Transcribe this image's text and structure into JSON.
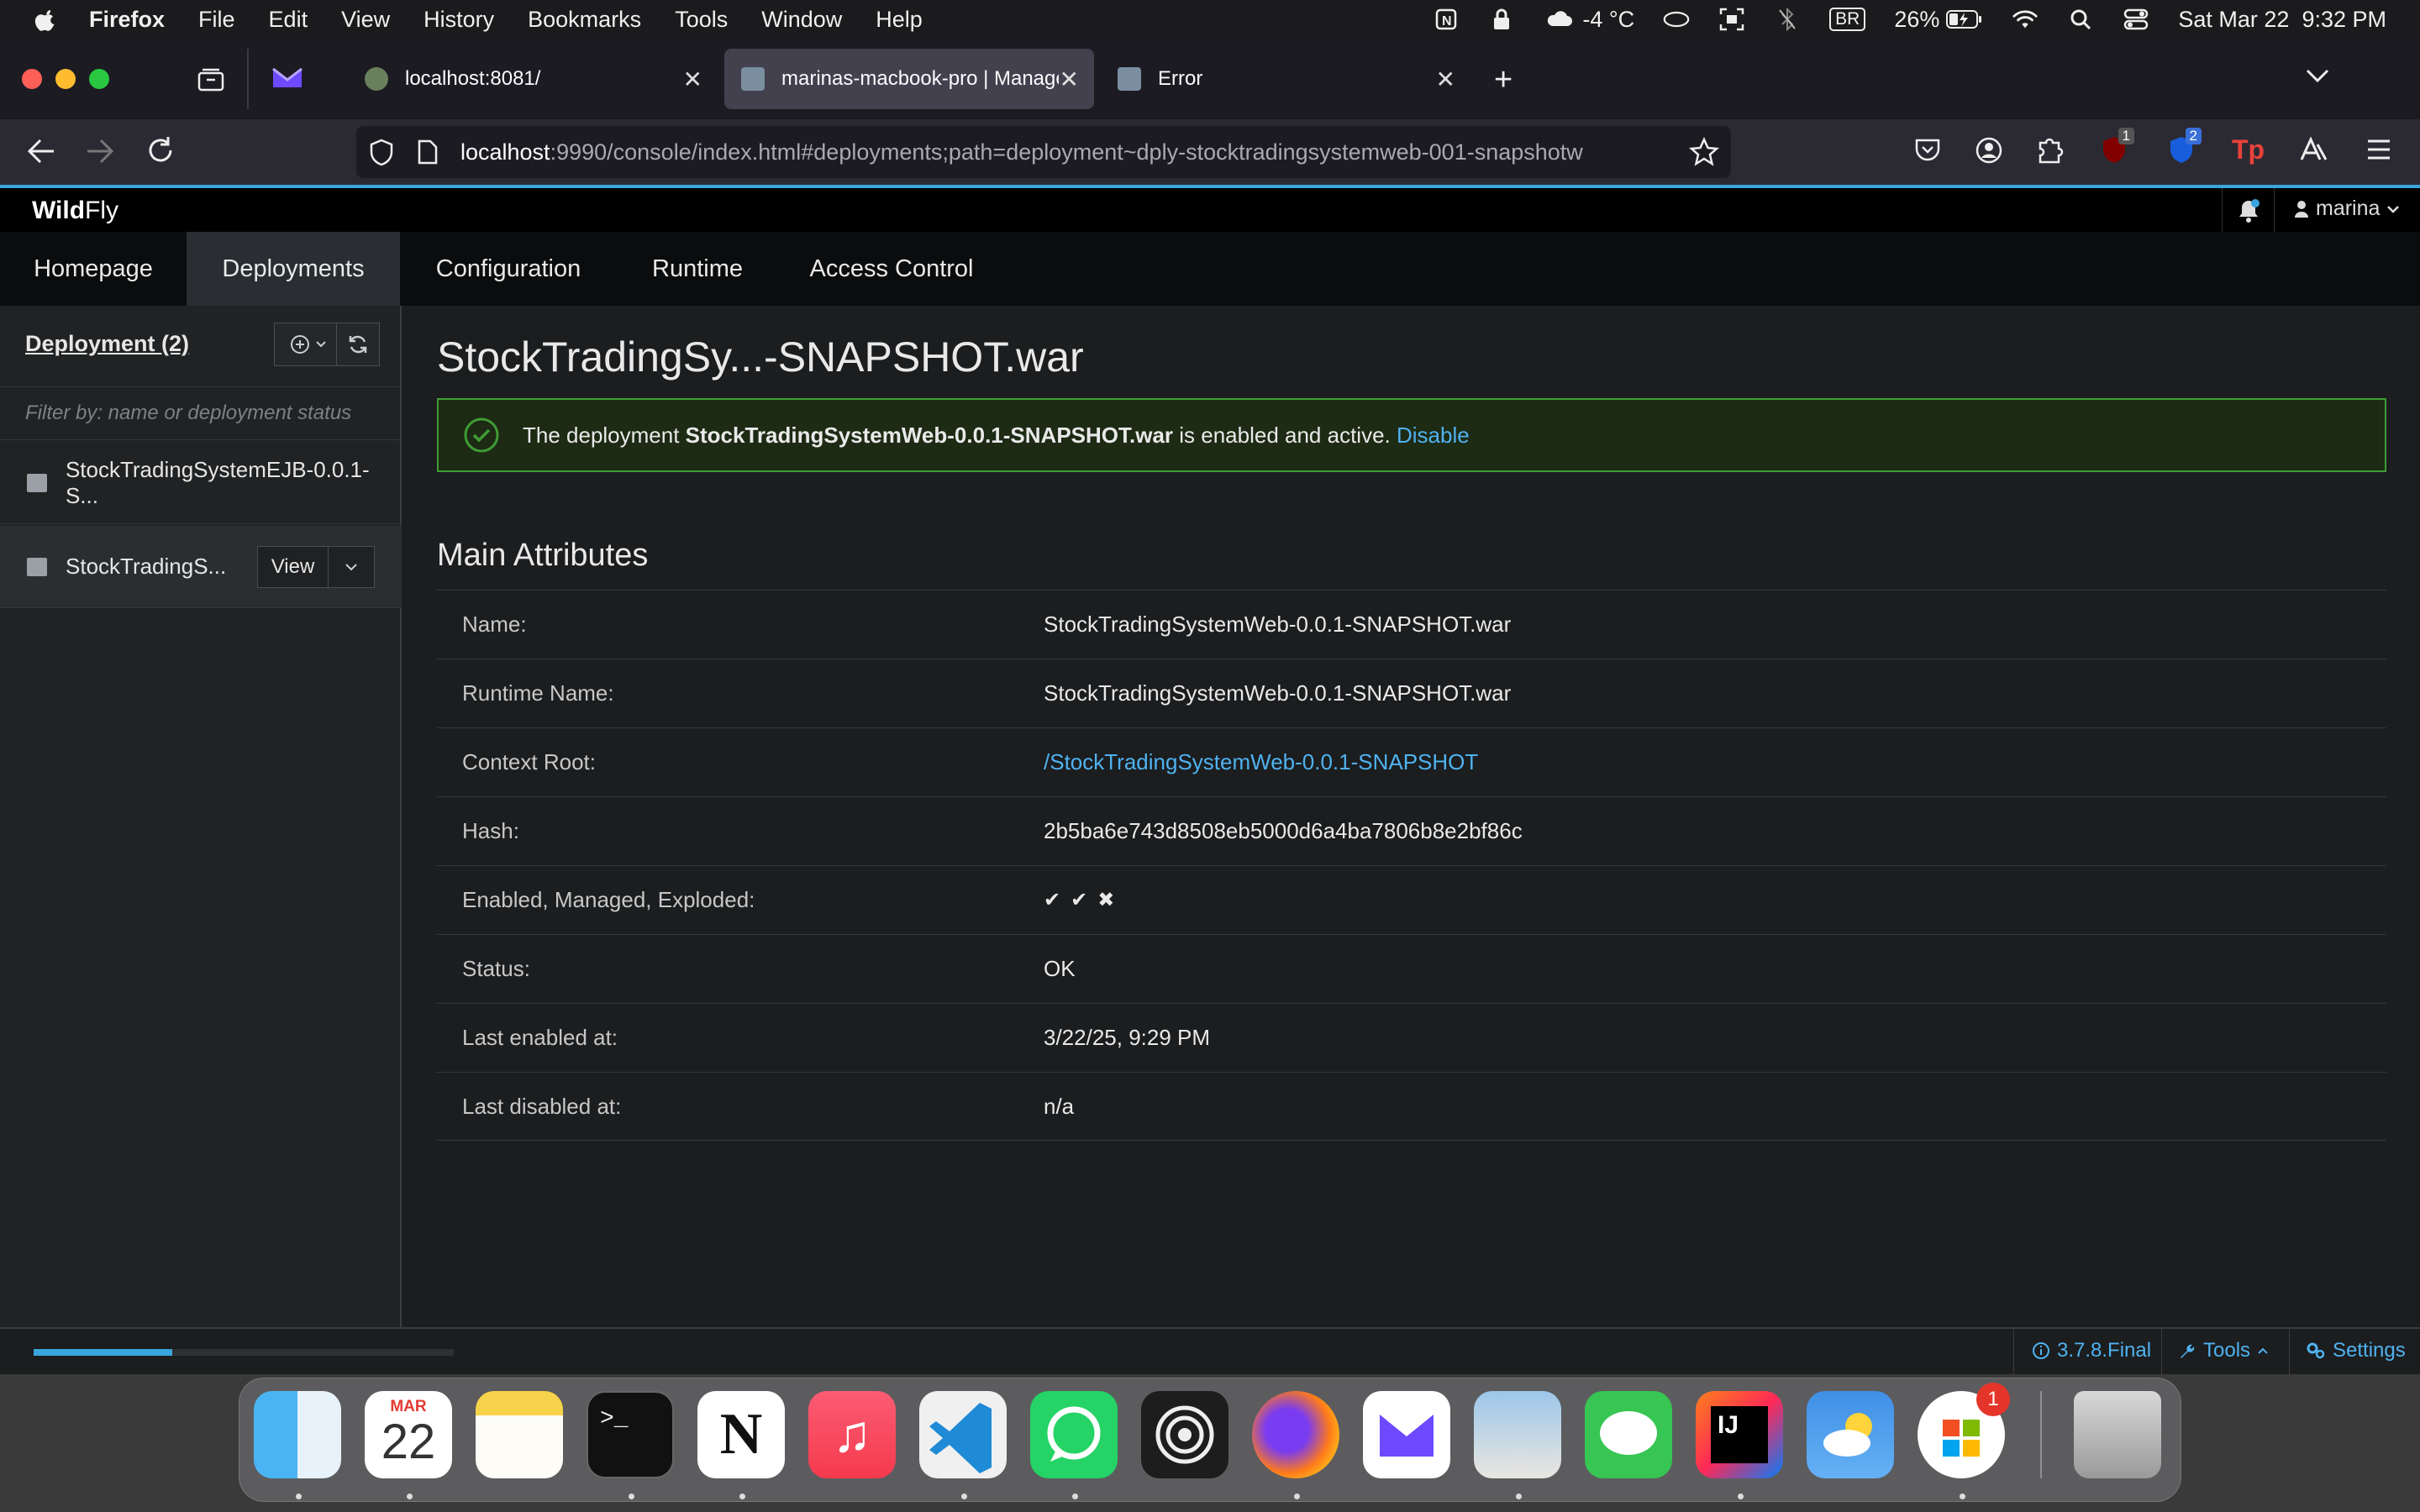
{
  "menubar": {
    "app_name": "Firefox",
    "items": [
      "File",
      "Edit",
      "View",
      "History",
      "Bookmarks",
      "Tools",
      "Window",
      "Help"
    ],
    "weather": "-4 °C",
    "input_source": "BR",
    "battery": "26%",
    "datetime": "Sat Mar 22  9:32 PM"
  },
  "tabs": [
    {
      "title": "localhost:8081/"
    },
    {
      "title": "marinas-macbook-pro | Manage"
    },
    {
      "title": "Error"
    }
  ],
  "urlbar": {
    "host": "localhost",
    "rest": ":9990/console/index.html#deployments;path=deployment~dply-stocktradingsystemweb-001-snapshotw"
  },
  "extensions": {
    "badge_1": "1",
    "badge_2": "2"
  },
  "brand": {
    "wild": "Wild",
    "fly": "Fly",
    "user": "marina"
  },
  "mainnav": [
    "Homepage",
    "Deployments",
    "Configuration",
    "Runtime",
    "Access Control"
  ],
  "sidebar": {
    "title": "Deployment (2)",
    "filter_placeholder": "Filter by: name or deployment status",
    "items": [
      {
        "label": "StockTradingSystemEJB-0.0.1-S..."
      },
      {
        "label": "StockTradingS...",
        "view_label": "View"
      }
    ]
  },
  "content": {
    "title": "StockTradingSy...-SNAPSHOT.war",
    "alert": {
      "prefix": "The deployment ",
      "name": "StockTradingSystemWeb-0.0.1-SNAPSHOT.war",
      "suffix": " is enabled and active. ",
      "link": "Disable"
    },
    "section_title": "Main Attributes",
    "attributes": [
      {
        "key": "Name:",
        "value": "StockTradingSystemWeb-0.0.1-SNAPSHOT.war"
      },
      {
        "key": "Runtime Name:",
        "value": "StockTradingSystemWeb-0.0.1-SNAPSHOT.war"
      },
      {
        "key": "Context Root:",
        "value": "/StockTradingSystemWeb-0.0.1-SNAPSHOT"
      },
      {
        "key": "Hash:",
        "value": "2b5ba6e743d8508eb5000d6a4ba7806b8e2bf86c"
      },
      {
        "key": "Enabled, Managed, Exploded:",
        "value": ""
      },
      {
        "key": "Status:",
        "value": "OK"
      },
      {
        "key": "Last enabled at:",
        "value": "3/22/25, 9:29 PM"
      },
      {
        "key": "Last disabled at:",
        "value": "n/a"
      }
    ],
    "flags": {
      "enabled": "✔",
      "managed": "✔",
      "exploded": "✖"
    }
  },
  "footer": {
    "version": "3.7.8.Final",
    "tools": "Tools",
    "settings": "Settings",
    "progress": 0.33
  },
  "dock": {
    "calendar_month": "MAR",
    "calendar_day": "22",
    "badge": "1",
    "apps": [
      "finder-icon",
      "calendar-icon",
      "notes-icon",
      "terminal-icon",
      "notion-icon",
      "music-icon",
      "vscode-icon",
      "whatsapp-icon",
      "perplexity-icon",
      "firefox-icon",
      "proton-mail-icon",
      "preview-icon",
      "messages-icon",
      "intellij-icon",
      "weather-icon",
      "office-installer-icon",
      "trash-icon"
    ]
  },
  "colors": {
    "accent": "#39a5dc",
    "success": "#3f9c35",
    "link": "#4fb2ef"
  }
}
